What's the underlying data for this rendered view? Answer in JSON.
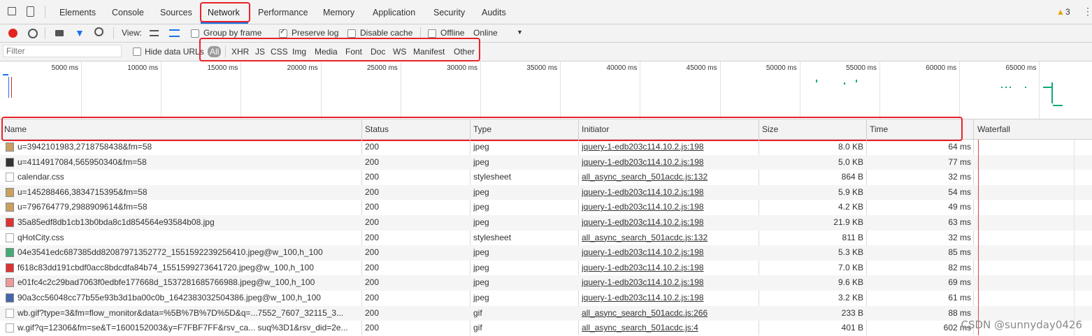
{
  "tabs": [
    {
      "label": "Elements"
    },
    {
      "label": "Console"
    },
    {
      "label": "Sources"
    },
    {
      "label": "Network"
    },
    {
      "label": "Performance"
    },
    {
      "label": "Memory"
    },
    {
      "label": "Application"
    },
    {
      "label": "Security"
    },
    {
      "label": "Audits"
    }
  ],
  "active_tab": "Network",
  "warning_count": "3",
  "toolbar": {
    "view_label": "View:",
    "group_by_frame": "Group by frame",
    "preserve_log": "Preserve log",
    "disable_cache": "Disable cache",
    "offline": "Offline",
    "throttle": "Online"
  },
  "filter": {
    "placeholder": "Filter",
    "hide_data_urls": "Hide data URLs",
    "types": [
      "All",
      "XHR",
      "JS",
      "CSS",
      "Img",
      "Media",
      "Font",
      "Doc",
      "WS",
      "Manifest",
      "Other"
    ]
  },
  "overview_ticks": [
    "5000 ms",
    "10000 ms",
    "15000 ms",
    "20000 ms",
    "25000 ms",
    "30000 ms",
    "35000 ms",
    "40000 ms",
    "45000 ms",
    "50000 ms",
    "55000 ms",
    "60000 ms",
    "65000 ms",
    "70"
  ],
  "columns": [
    "Name",
    "Status",
    "Type",
    "Initiator",
    "Size",
    "Time",
    "Waterfall"
  ],
  "rows": [
    {
      "name": "u=3942101983,2718758438&fm=58",
      "status": "200",
      "type": "jpeg",
      "initiator": "jquery-1-edb203c114.10.2.js:198",
      "size": "8.0 KB",
      "time": "64 ms",
      "icon": "img"
    },
    {
      "name": "u=4114917084,565950340&fm=58",
      "status": "200",
      "type": "jpeg",
      "initiator": "jquery-1-edb203c114.10.2.js:198",
      "size": "5.0 KB",
      "time": "77 ms",
      "icon": "img-dark"
    },
    {
      "name": "calendar.css",
      "status": "200",
      "type": "stylesheet",
      "initiator": "all_async_search_501acdc.js:132",
      "size": "864 B",
      "time": "32 ms",
      "icon": "doc"
    },
    {
      "name": "u=145288466,3834715395&fm=58",
      "status": "200",
      "type": "jpeg",
      "initiator": "jquery-1-edb203c114.10.2.js:198",
      "size": "5.9 KB",
      "time": "54 ms",
      "icon": "img"
    },
    {
      "name": "u=796764779,2988909614&fm=58",
      "status": "200",
      "type": "jpeg",
      "initiator": "jquery-1-edb203c114.10.2.js:198",
      "size": "4.2 KB",
      "time": "49 ms",
      "icon": "img"
    },
    {
      "name": "35a85edf8db1cb13b0bda8c1d854564e93584b08.jpg",
      "status": "200",
      "type": "jpeg",
      "initiator": "jquery-1-edb203c114.10.2.js:198",
      "size": "21.9 KB",
      "time": "63 ms",
      "icon": "img-red"
    },
    {
      "name": "qHotCity.css",
      "status": "200",
      "type": "stylesheet",
      "initiator": "all_async_search_501acdc.js:132",
      "size": "811 B",
      "time": "32 ms",
      "icon": "doc"
    },
    {
      "name": "04e3541edc687385dd82087971352772_1551592239256410.jpeg@w_100,h_100",
      "status": "200",
      "type": "jpeg",
      "initiator": "jquery-1-edb203c114.10.2.js:198",
      "size": "5.3 KB",
      "time": "85 ms",
      "icon": "img-green"
    },
    {
      "name": "f618c83dd191cbdf0acc8bdcdfa84b74_1551599273641720.jpeg@w_100,h_100",
      "status": "200",
      "type": "jpeg",
      "initiator": "jquery-1-edb203c114.10.2.js:198",
      "size": "7.0 KB",
      "time": "82 ms",
      "icon": "img-red"
    },
    {
      "name": "e01fc4c2c29bad7063f0edbfe177668d_1537281685766988.jpeg@w_100,h_100",
      "status": "200",
      "type": "jpeg",
      "initiator": "jquery-1-edb203c114.10.2.js:198",
      "size": "9.6 KB",
      "time": "69 ms",
      "icon": "img-pink"
    },
    {
      "name": "90a3cc56048cc77b55e93b3d1ba00c0b_1642383032504386.jpeg@w_100,h_100",
      "status": "200",
      "type": "jpeg",
      "initiator": "jquery-1-edb203c114.10.2.js:198",
      "size": "3.2 KB",
      "time": "61 ms",
      "icon": "img-blue"
    },
    {
      "name": "wb.gif?type=3&fm=flow_monitor&data=%5B%7B%7D%5D&q=...7552_7607_32115_3...",
      "status": "200",
      "type": "gif",
      "initiator": "all_async_search_501acdc.js:266",
      "size": "233 B",
      "time": "88 ms",
      "icon": "doc"
    },
    {
      "name": "w.gif?q=12306&fm=se&T=1600152003&y=F7FBF7FF&rsv_ca... suq%3D1&rsv_did=2e...",
      "status": "200",
      "type": "gif",
      "initiator": "all_async_search_501acdc.js:4",
      "size": "401 B",
      "time": "602 ms",
      "icon": "doc"
    }
  ],
  "watermark": "CSDN @sunnyday0426",
  "colors": {
    "highlight": "#e8232b",
    "record": "#e0261f",
    "accent": "#1a73e8"
  }
}
